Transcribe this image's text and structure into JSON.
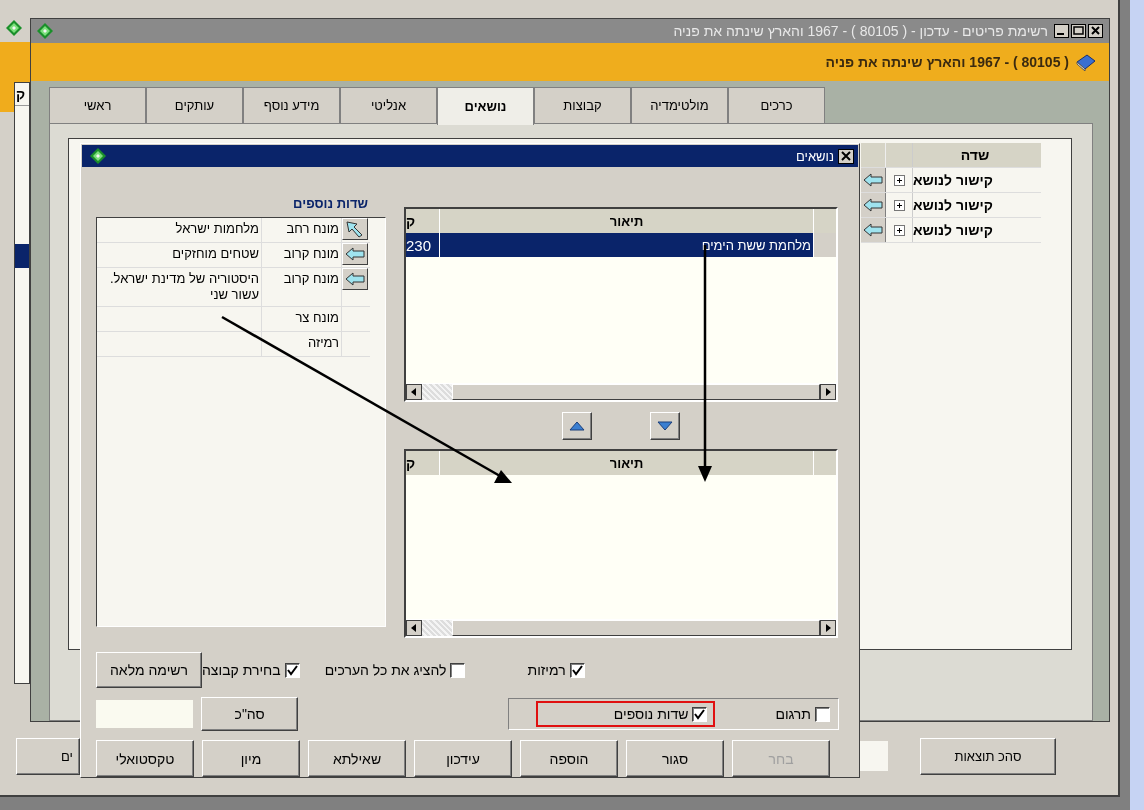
{
  "back_window": {
    "list_header": "ק",
    "bottom_buttons": [
      {
        "label": "סהכ תוצאות"
      },
      {
        "label": "ים"
      }
    ]
  },
  "window": {
    "title": "רשימת פריטים - עדכון - ( 80105 ) - 1967  והארץ שינתה את פניה",
    "header": "( 80105 ) - 1967  והארץ שינתה את פניה"
  },
  "tabs": [
    {
      "label": "כרכים",
      "selected": false
    },
    {
      "label": "מולטימדיה",
      "selected": false
    },
    {
      "label": "קבוצות",
      "selected": false
    },
    {
      "label": "נושאים",
      "selected": true
    },
    {
      "label": "אנליטי",
      "selected": false
    },
    {
      "label": "מידע נוסף",
      "selected": false
    },
    {
      "label": "עותקים",
      "selected": false
    },
    {
      "label": "ראשי",
      "selected": false
    }
  ],
  "fields_table": {
    "header": "שדה",
    "rows": [
      {
        "label": "קישור לנושא"
      },
      {
        "label": "קישור לנושא"
      },
      {
        "label": "קישור לנושא"
      }
    ]
  },
  "dialog": {
    "title": "נושאים",
    "extra_fields": {
      "title": "שדות נוספים",
      "rows": [
        {
          "kind": "pointer",
          "term": "מונח רחב",
          "value": "מלחמות ישראל"
        },
        {
          "kind": "arrow",
          "term": "מונח קרוב",
          "value": "שטחים מוחזקים"
        },
        {
          "kind": "arrow",
          "term": "מונח קרוב",
          "value": "היסטוריה של מדינת ישראל. עשור שני"
        },
        {
          "kind": "plain",
          "term": "מונח צר"
        },
        {
          "kind": "plain",
          "term": "רמיזה"
        }
      ]
    },
    "top_list": {
      "columns": [
        "תיאור",
        "ק"
      ],
      "rows": [
        {
          "code": "230",
          "description": "מלחמת ששת הימים",
          "selected": true
        }
      ]
    },
    "bottom_list": {
      "columns": [
        "תיאור",
        "ק"
      ]
    },
    "full_list_button": "רשימה מלאה",
    "total_button": "סה\"כ",
    "options": [
      {
        "label": "רמיזות",
        "checked": true
      },
      {
        "label": "להציג את כל הערכים",
        "checked": false
      },
      {
        "label": "בחירת קבוצה",
        "checked": true
      }
    ],
    "group_options": [
      {
        "label": "תרגום",
        "checked": false
      },
      {
        "label": "שדות נוספים",
        "checked": true,
        "highlighted": true
      }
    ],
    "buttons": [
      {
        "label": "בחר",
        "disabled": true
      },
      {
        "label": "סגור",
        "disabled": false
      },
      {
        "label": "הוספה",
        "disabled": false
      },
      {
        "label": "עידכון",
        "disabled": false
      },
      {
        "label": "שאילתא",
        "disabled": false
      },
      {
        "label": "מיון",
        "disabled": false
      },
      {
        "label": "טקסטואלי",
        "disabled": false
      }
    ]
  }
}
